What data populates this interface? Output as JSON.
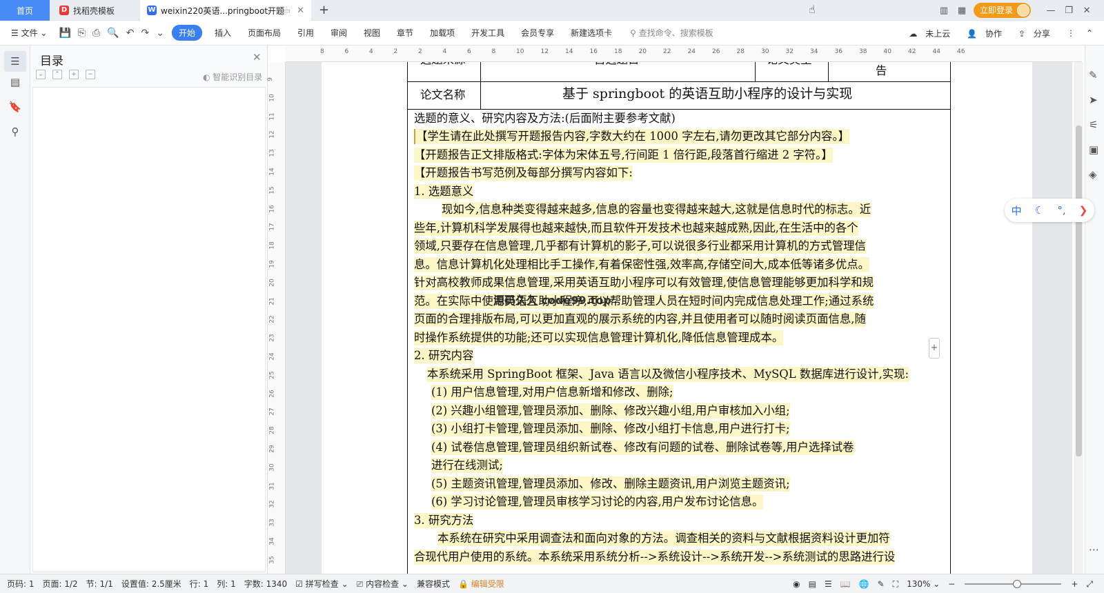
{
  "tabs": {
    "home": "首页",
    "template": "找稻壳模板",
    "doc": "weixin220英语...pringboot开题"
  },
  "titlebar": {
    "login": "立即登录"
  },
  "menu": {
    "file": "文件",
    "items": [
      "开始",
      "插入",
      "页面布局",
      "引用",
      "审阅",
      "视图",
      "章节",
      "加载项",
      "开发工具",
      "会员专享",
      "新建选项卡"
    ],
    "search_placeholder": "查找命令、搜索模板",
    "cloud": "未上云",
    "collab": "协作",
    "share": "分享"
  },
  "toc": {
    "title": "目录",
    "smart": "智能识别目录"
  },
  "ruler": {
    "h": [
      "8",
      "6",
      "4",
      "2",
      "2",
      "4",
      "6",
      "8",
      "10",
      "12",
      "14",
      "16",
      "18",
      "20",
      "22",
      "24",
      "26",
      "28",
      "30",
      "32",
      "34",
      "36",
      "38",
      "40",
      "42",
      "44",
      "46"
    ],
    "v": [
      "9",
      "10",
      "11",
      "12",
      "13",
      "14",
      "15",
      "16",
      "17",
      "18",
      "19",
      "20",
      "21",
      "22",
      "23",
      "24",
      "25",
      "26",
      "27",
      "28",
      "29",
      "30",
      "31",
      "32",
      "33",
      "34",
      "35"
    ]
  },
  "doc": {
    "row1": {
      "c1": "选题来源",
      "c2": "自选题目",
      "c3": "论文类型",
      "c4": "告"
    },
    "row2": {
      "label": "论文名称",
      "title": "基于 springboot 的英语互助小程序的设计与实现"
    },
    "lines": [
      "选题的意义、研究内容及方法:(后面附主要参考文献)",
      "【学生请在此处撰写开题报告内容,字数大约在 1000 字左右,请勿更改其它部分内容。】",
      "【开题报告正文排版格式:字体为宋体五号,行间距 1 倍行距,段落首行缩进 2 字符。】",
      "【开题报告书写范例及每部分撰写内容如下:",
      "1.   选题意义",
      "现如今,信息种类变得越来越多,信息的容量也变得越来越大,这就是信息时代的标志。近",
      "些年,计算机科学发展得也越来越快,而且软件开发技术也越来越成熟,因此,在生活中的各个",
      "领域,只要存在信息管理,几乎都有计算机的影子,可以说很多行业都采用计算机的方式管理信",
      "息。信息计算机化处理相比手工操作,有着保密性强,效率高,存储空间大,成本低等诸多优点。",
      "针对高校教师成果信息管理,采用英语互助小程序可以有效管理,使信息管理能够更加科学和规",
      "范。在实际中使用英语互助小程序,可以帮助管理人员在短时间内完成信息处理工作;通过系统",
      "页面的合理排版布局,可以更加直观的展示系统的内容,并且使用者可以随时阅读页面信息,随",
      "时操作系统提供的功能;还可以实现信息管理计算机化,降低信息管理成本。",
      "2.   研究内容",
      "本系统采用 SpringBoot 框架、Java 语言以及微信小程序技术、MySQL 数据库进行设计,实现:",
      "(1)    用户信息管理,对用户信息新增和修改、删除;",
      "(2)    兴趣小组管理,管理员添加、删除、修改兴趣小组,用户审核加入小组;",
      "(3)    小组打卡管理,管理员添加、删除、修改小组打卡信息,用户进行打卡;",
      "(4)    试卷信息管理,管理员组织新试卷、修改有问题的试卷、删除试卷等,用户选择试卷",
      "           进行在线测试;",
      "(5)    主题资讯管理,管理员添加、修改、删除主题资讯,用户浏览主题资讯;",
      "(6)    学习讨论管理,管理员审核学习讨论的内容,用户发布讨论信息。",
      "3.   研究方法",
      "本系统在研究中采用调查法和面向对象的方法。调查相关的资料与文献根据资料设计更加符",
      "合现代用户使用的系统。本系统采用系统分析-->系统设计-->系统开发-->系统测试的思路进行设"
    ],
    "watermark": "源码久久 code99.top"
  },
  "ime": {
    "lang": "中"
  },
  "status": {
    "page_code": "页码: 1",
    "pages": "页面: 1/2",
    "section": "节: 1/1",
    "setting": "设置值: 2.5厘米",
    "row": "行: 1",
    "col": "列: 1",
    "words": "字数: 1340",
    "spell": "拼写检查",
    "content": "内容检查",
    "compat": "兼容模式",
    "restrict": "编辑受限",
    "zoom": "130%"
  }
}
